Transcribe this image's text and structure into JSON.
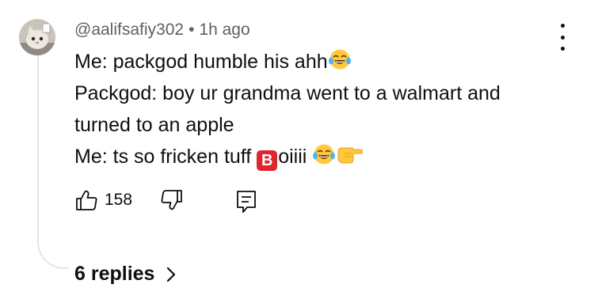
{
  "comment": {
    "author": "@aalifsafiy302",
    "separator": "•",
    "time": "1h ago",
    "lines": [
      "Me: packgod humble his ahh",
      "Packgod: boy ur grandma went to a walmart and",
      "turned to an apple",
      "Me: ts so fricken tuff "
    ],
    "b_badge": "B",
    "line4_tail": "oiiii",
    "likes": "158"
  },
  "replies": {
    "label": "6 replies"
  },
  "icons": {
    "more": "more-vertical-icon",
    "like": "thumbs-up-icon",
    "dislike": "thumbs-down-icon",
    "reply": "reply-comment-icon",
    "chevron": "chevron-right-icon",
    "laugh": "face-with-tears-of-joy-emoji",
    "point": "backhand-index-pointing-right-emoji"
  },
  "colors": {
    "text": "#0f0f0f",
    "meta": "#606060",
    "badge": "#e0262d",
    "thread": "#e5e5e5"
  }
}
